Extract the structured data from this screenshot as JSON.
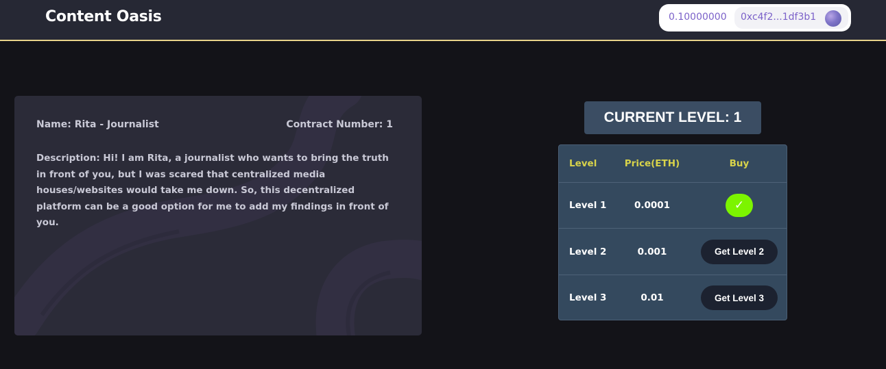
{
  "header": {
    "brand": "Content Oasis",
    "wallet": {
      "balance": "0.10000000",
      "address": "0xc4f2...1df3b1",
      "avatar_icon": "wallet-avatar-icon"
    }
  },
  "profile": {
    "name": "Name: Rita - Journalist",
    "contract": "Contract Number: 1",
    "description": "Description: Hi! I am Rita, a journalist who wants to bring the truth in front of you, but I was scared that centralized media houses/websites would take me down. So, this decentralized platform can be a good option for me to add my findings in front of you."
  },
  "current_level": "CURRENT LEVEL: 1",
  "levels_table": {
    "headers": [
      "Level",
      "Price(ETH)",
      "Buy"
    ],
    "rows": [
      {
        "level": "Level 1",
        "price": "0.0001",
        "buy": "✓",
        "owned": true
      },
      {
        "level": "Level 2",
        "price": "0.001",
        "buy": "Get Level 2",
        "owned": false
      },
      {
        "level": "Level 3",
        "price": "0.01",
        "buy": "Get Level 3",
        "owned": false
      }
    ]
  },
  "colors": {
    "background": "#131318",
    "header": "#262834",
    "header_border": "#e8d38a",
    "card": "#2b2b38",
    "table": "#34495e",
    "table_header_text": "#d8d34a",
    "owned_check": "#7cf400",
    "buy_button": "#1c2230",
    "wallet_text": "#7b61c9"
  }
}
